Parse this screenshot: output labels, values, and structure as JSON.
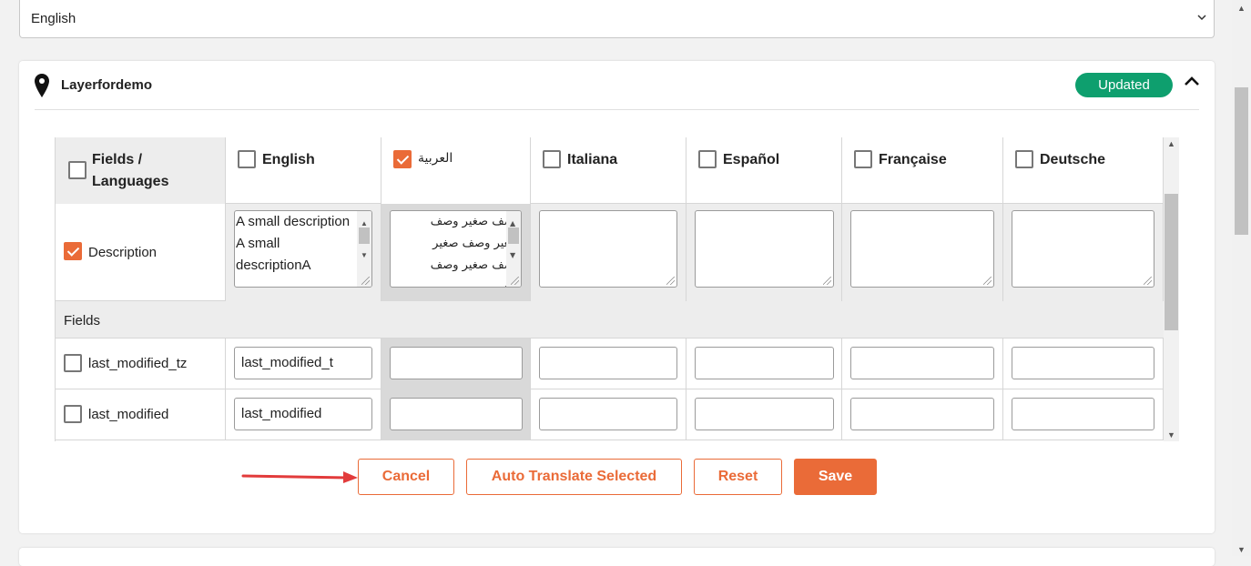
{
  "language_select": {
    "value": "English"
  },
  "layer": {
    "title": "Layerfordemo",
    "status": "Updated"
  },
  "table": {
    "header_label": "Fields / Languages",
    "header_label_line1": "Fields /",
    "header_label_line2": "Languages",
    "languages": [
      "English",
      "العربية",
      "Italiana",
      "Español",
      "Française",
      "Deutsche"
    ],
    "languages_checked": [
      false,
      true,
      false,
      false,
      false,
      false
    ],
    "description": {
      "label": "Description",
      "checked": true,
      "english_text": "A small description A small descriptionA",
      "arabic_text": "وصف صغير وصف صغير وصف صغير وصف صغير وصف صغير"
    },
    "fields_section_label": "Fields",
    "fields": [
      {
        "name": "last_modified_tz",
        "checked": false,
        "english_value": "last_modified_t"
      },
      {
        "name": "last_modified",
        "checked": false,
        "english_value": "last_modified"
      }
    ]
  },
  "buttons": {
    "cancel": "Cancel",
    "auto_translate": "Auto Translate Selected",
    "reset": "Reset",
    "save": "Save"
  },
  "colors": {
    "accent": "#ea6b38",
    "badge": "#0e9f6e",
    "arrow": "#e23b3b"
  }
}
